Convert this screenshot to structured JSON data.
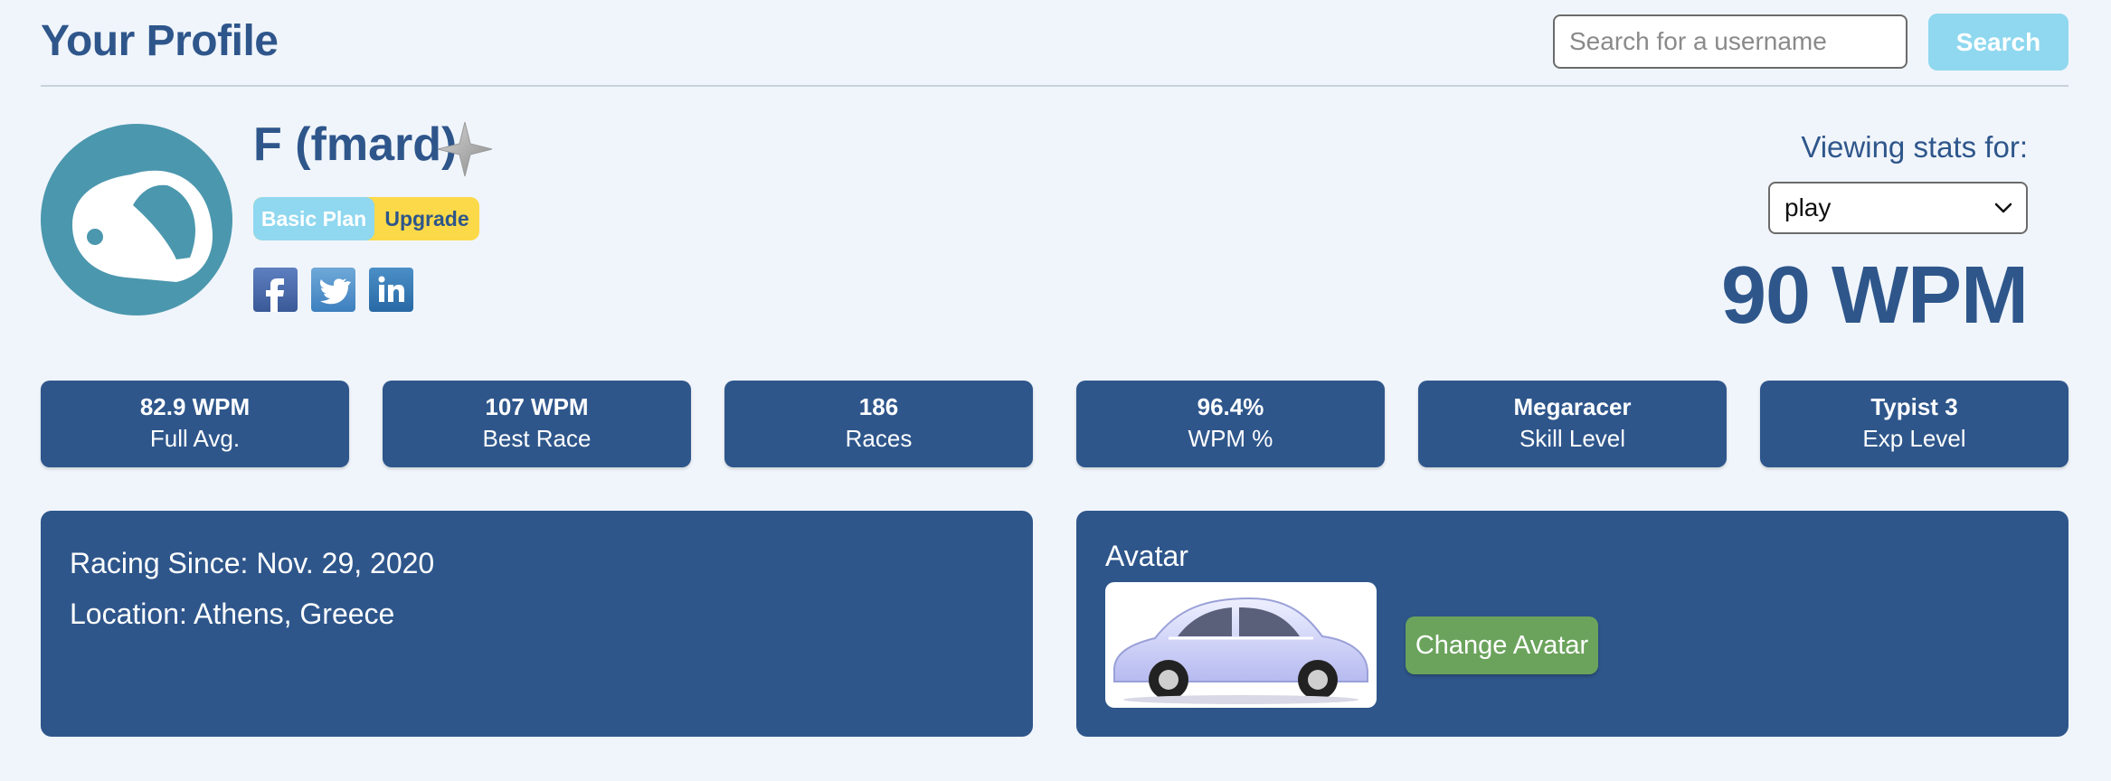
{
  "header": {
    "title": "Your Profile",
    "search_placeholder": "Search for a username",
    "search_button": "Search"
  },
  "profile": {
    "display_name": "F (fmard)",
    "plan_label": "Basic Plan",
    "upgrade_label": "Upgrade",
    "social_links": [
      {
        "name": "facebook-icon",
        "glyph": "f"
      },
      {
        "name": "twitter-icon",
        "glyph": "t"
      },
      {
        "name": "linkedin-icon",
        "glyph": "in"
      }
    ]
  },
  "stats_selector": {
    "label": "Viewing stats for:",
    "selected": "play",
    "wpm": "90 WPM"
  },
  "stats": [
    {
      "value": "82.9 WPM",
      "label": "Full Avg."
    },
    {
      "value": "107 WPM",
      "label": "Best Race"
    },
    {
      "value": "186",
      "label": "Races"
    },
    {
      "value": "96.4%",
      "label": "WPM %"
    },
    {
      "value": "Megaracer",
      "label": "Skill Level"
    },
    {
      "value": "Typist 3",
      "label": "Exp Level"
    }
  ],
  "info": {
    "racing_since": "Racing Since: Nov. 29, 2020",
    "location": "Location: Athens, Greece"
  },
  "avatar_panel": {
    "title": "Avatar",
    "change_button": "Change Avatar"
  },
  "colors": {
    "primary": "#2e568b",
    "background": "#f0f5fb",
    "accent_light_blue": "#8fd8ef",
    "upgrade_yellow": "#fcd949",
    "avatar_teal": "#4b97ae",
    "button_green": "#6ba35c"
  }
}
